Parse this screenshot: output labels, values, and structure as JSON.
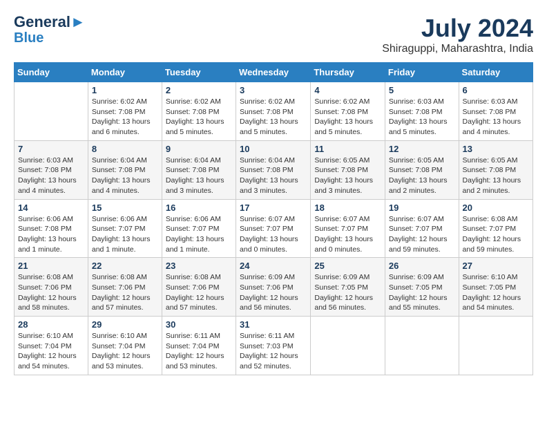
{
  "header": {
    "logo_line1": "General",
    "logo_line2": "Blue",
    "month_year": "July 2024",
    "location": "Shiraguppi, Maharashtra, India"
  },
  "days_of_week": [
    "Sunday",
    "Monday",
    "Tuesday",
    "Wednesday",
    "Thursday",
    "Friday",
    "Saturday"
  ],
  "weeks": [
    [
      {
        "day": "",
        "info": ""
      },
      {
        "day": "1",
        "info": "Sunrise: 6:02 AM\nSunset: 7:08 PM\nDaylight: 13 hours\nand 6 minutes."
      },
      {
        "day": "2",
        "info": "Sunrise: 6:02 AM\nSunset: 7:08 PM\nDaylight: 13 hours\nand 5 minutes."
      },
      {
        "day": "3",
        "info": "Sunrise: 6:02 AM\nSunset: 7:08 PM\nDaylight: 13 hours\nand 5 minutes."
      },
      {
        "day": "4",
        "info": "Sunrise: 6:02 AM\nSunset: 7:08 PM\nDaylight: 13 hours\nand 5 minutes."
      },
      {
        "day": "5",
        "info": "Sunrise: 6:03 AM\nSunset: 7:08 PM\nDaylight: 13 hours\nand 5 minutes."
      },
      {
        "day": "6",
        "info": "Sunrise: 6:03 AM\nSunset: 7:08 PM\nDaylight: 13 hours\nand 4 minutes."
      }
    ],
    [
      {
        "day": "7",
        "info": "Sunrise: 6:03 AM\nSunset: 7:08 PM\nDaylight: 13 hours\nand 4 minutes."
      },
      {
        "day": "8",
        "info": "Sunrise: 6:04 AM\nSunset: 7:08 PM\nDaylight: 13 hours\nand 4 minutes."
      },
      {
        "day": "9",
        "info": "Sunrise: 6:04 AM\nSunset: 7:08 PM\nDaylight: 13 hours\nand 3 minutes."
      },
      {
        "day": "10",
        "info": "Sunrise: 6:04 AM\nSunset: 7:08 PM\nDaylight: 13 hours\nand 3 minutes."
      },
      {
        "day": "11",
        "info": "Sunrise: 6:05 AM\nSunset: 7:08 PM\nDaylight: 13 hours\nand 3 minutes."
      },
      {
        "day": "12",
        "info": "Sunrise: 6:05 AM\nSunset: 7:08 PM\nDaylight: 13 hours\nand 2 minutes."
      },
      {
        "day": "13",
        "info": "Sunrise: 6:05 AM\nSunset: 7:08 PM\nDaylight: 13 hours\nand 2 minutes."
      }
    ],
    [
      {
        "day": "14",
        "info": "Sunrise: 6:06 AM\nSunset: 7:08 PM\nDaylight: 13 hours\nand 1 minute."
      },
      {
        "day": "15",
        "info": "Sunrise: 6:06 AM\nSunset: 7:07 PM\nDaylight: 13 hours\nand 1 minute."
      },
      {
        "day": "16",
        "info": "Sunrise: 6:06 AM\nSunset: 7:07 PM\nDaylight: 13 hours\nand 1 minute."
      },
      {
        "day": "17",
        "info": "Sunrise: 6:07 AM\nSunset: 7:07 PM\nDaylight: 13 hours\nand 0 minutes."
      },
      {
        "day": "18",
        "info": "Sunrise: 6:07 AM\nSunset: 7:07 PM\nDaylight: 13 hours\nand 0 minutes."
      },
      {
        "day": "19",
        "info": "Sunrise: 6:07 AM\nSunset: 7:07 PM\nDaylight: 12 hours\nand 59 minutes."
      },
      {
        "day": "20",
        "info": "Sunrise: 6:08 AM\nSunset: 7:07 PM\nDaylight: 12 hours\nand 59 minutes."
      }
    ],
    [
      {
        "day": "21",
        "info": "Sunrise: 6:08 AM\nSunset: 7:06 PM\nDaylight: 12 hours\nand 58 minutes."
      },
      {
        "day": "22",
        "info": "Sunrise: 6:08 AM\nSunset: 7:06 PM\nDaylight: 12 hours\nand 57 minutes."
      },
      {
        "day": "23",
        "info": "Sunrise: 6:08 AM\nSunset: 7:06 PM\nDaylight: 12 hours\nand 57 minutes."
      },
      {
        "day": "24",
        "info": "Sunrise: 6:09 AM\nSunset: 7:06 PM\nDaylight: 12 hours\nand 56 minutes."
      },
      {
        "day": "25",
        "info": "Sunrise: 6:09 AM\nSunset: 7:05 PM\nDaylight: 12 hours\nand 56 minutes."
      },
      {
        "day": "26",
        "info": "Sunrise: 6:09 AM\nSunset: 7:05 PM\nDaylight: 12 hours\nand 55 minutes."
      },
      {
        "day": "27",
        "info": "Sunrise: 6:10 AM\nSunset: 7:05 PM\nDaylight: 12 hours\nand 54 minutes."
      }
    ],
    [
      {
        "day": "28",
        "info": "Sunrise: 6:10 AM\nSunset: 7:04 PM\nDaylight: 12 hours\nand 54 minutes."
      },
      {
        "day": "29",
        "info": "Sunrise: 6:10 AM\nSunset: 7:04 PM\nDaylight: 12 hours\nand 53 minutes."
      },
      {
        "day": "30",
        "info": "Sunrise: 6:11 AM\nSunset: 7:04 PM\nDaylight: 12 hours\nand 53 minutes."
      },
      {
        "day": "31",
        "info": "Sunrise: 6:11 AM\nSunset: 7:03 PM\nDaylight: 12 hours\nand 52 minutes."
      },
      {
        "day": "",
        "info": ""
      },
      {
        "day": "",
        "info": ""
      },
      {
        "day": "",
        "info": ""
      }
    ]
  ]
}
